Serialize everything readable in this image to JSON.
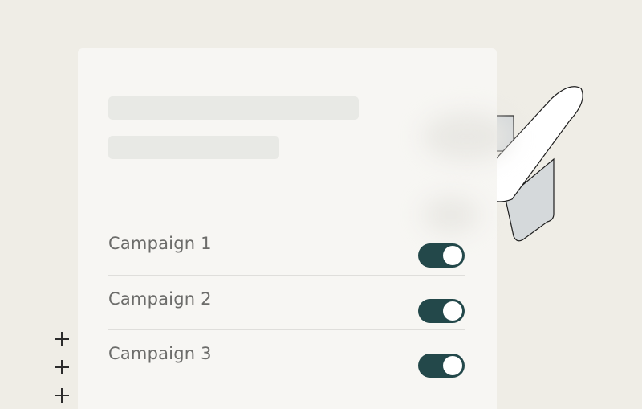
{
  "campaigns": [
    {
      "label": "Campaign 1",
      "enabled": true
    },
    {
      "label": "Campaign 2",
      "enabled": true
    },
    {
      "label": "Campaign 3",
      "enabled": true
    }
  ],
  "colors": {
    "background": "#efede6",
    "card": "#f7f6f3",
    "toggle_on": "#23484a",
    "skeleton": "#e8e9e5",
    "rocket_fin": "#d5d9db"
  },
  "icons": {
    "illustration": "rocket-icon",
    "decorations": "plus-icon"
  }
}
